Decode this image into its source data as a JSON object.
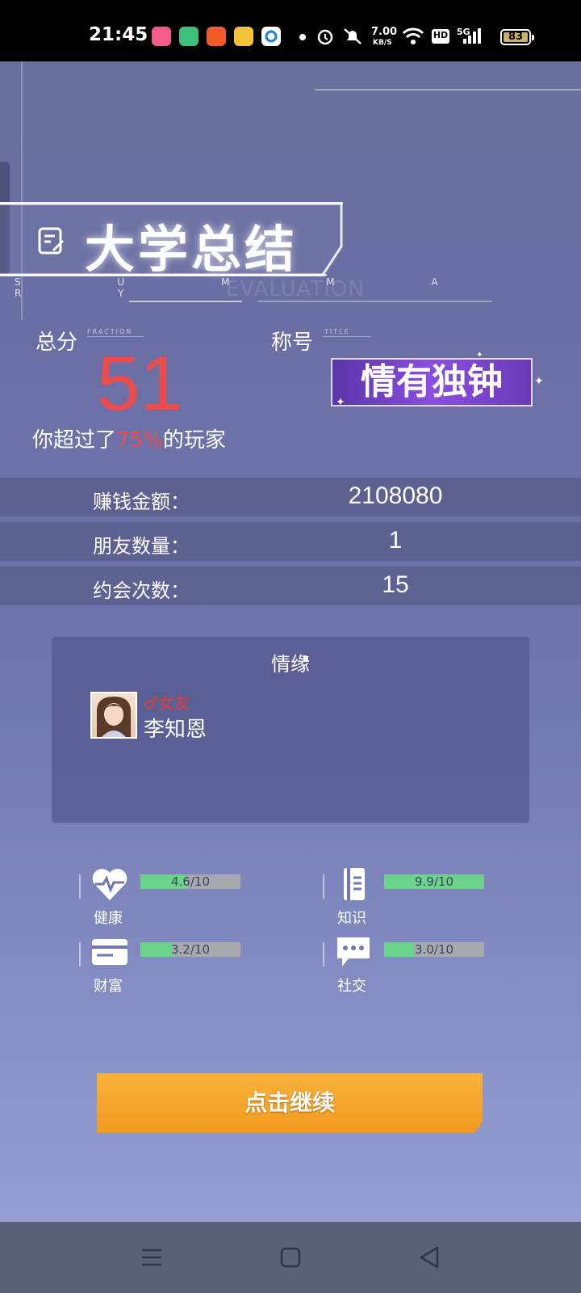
{
  "status_bar": {
    "time": "21:45",
    "network_speed_value": "7.00",
    "network_speed_unit": "KB/S",
    "hd": "HD",
    "network_type": "5G",
    "battery": "83",
    "app_icons": [
      "bilibili-icon",
      "green-app-icon",
      "orange-app-icon",
      "yellow-book-icon",
      "qq-browser-icon"
    ]
  },
  "header": {
    "title": "大学总结",
    "subtitle": "S U M M A R Y",
    "watermark": "EVALUATION"
  },
  "score": {
    "label": "总分",
    "label_en": "FRACTION",
    "value": "51",
    "surpass_prefix": "你超过了",
    "surpass_percent": "75%",
    "surpass_suffix": "的玩家"
  },
  "title_badge": {
    "label": "称号",
    "label_en": "TITLE",
    "value": "情有独钟"
  },
  "stats": [
    {
      "label": "赚钱金额：",
      "value": "2108080"
    },
    {
      "label": "朋友数量：",
      "value": "1"
    },
    {
      "label": "约会次数：",
      "value": "15"
    }
  ],
  "romance": {
    "header": "情缘",
    "relation": "♂女友",
    "name": "李知恩"
  },
  "attributes": [
    {
      "name": "健康",
      "icon": "heart-icon",
      "text": "4.6/10",
      "fraction": 0.46
    },
    {
      "name": "知识",
      "icon": "book-icon",
      "text": "9.9/10",
      "fraction": 0.99
    },
    {
      "name": "财富",
      "icon": "card-icon",
      "text": "3.2/10",
      "fraction": 0.32
    },
    {
      "name": "社交",
      "icon": "chat-icon",
      "text": "3.0/10",
      "fraction": 0.3
    }
  ],
  "continue_button": "点击继续",
  "nav": {
    "menu": "menu-icon",
    "home": "home-icon",
    "back": "back-icon"
  },
  "colors": {
    "score": "#ee4b4b",
    "button": "#f5a52c",
    "bar_fill": "#6bd38a",
    "badge": "#7a45d0"
  }
}
